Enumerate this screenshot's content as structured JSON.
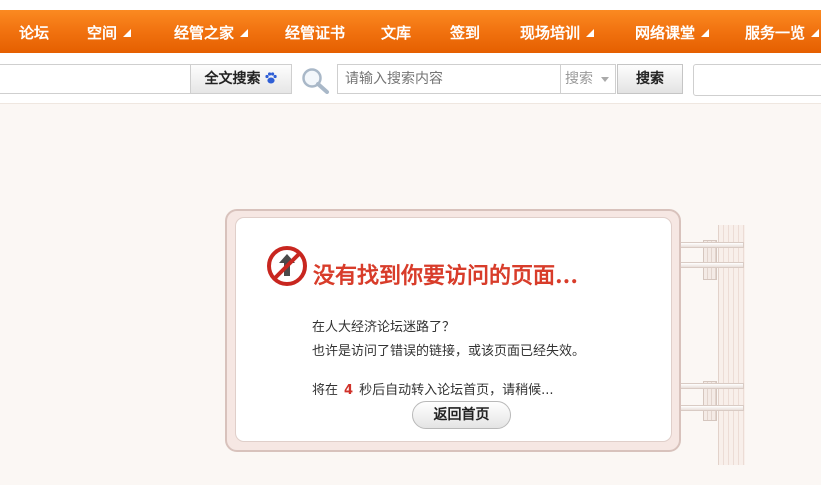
{
  "nav": {
    "items": [
      {
        "label": "论坛",
        "has_arrow": false
      },
      {
        "label": "空间",
        "has_arrow": true
      },
      {
        "label": "经管之家",
        "has_arrow": true
      },
      {
        "label": "经管证书",
        "has_arrow": false
      },
      {
        "label": "文库",
        "has_arrow": false
      },
      {
        "label": "签到",
        "has_arrow": false
      },
      {
        "label": "现场培训",
        "has_arrow": true
      },
      {
        "label": "网络课堂",
        "has_arrow": true
      },
      {
        "label": "服务一览",
        "has_arrow": true
      }
    ]
  },
  "search": {
    "fulltext_label": "全文搜索",
    "placeholder": "请输入搜索内容",
    "type_selected": "搜索",
    "button_label": "搜索"
  },
  "error": {
    "title": "没有找到你要访问的页面...",
    "line1": "在人大经济论坛迷路了？",
    "line2": "也许是访问了错误的链接，或该页面已经失效。",
    "countdown_prefix": "将在",
    "countdown_seconds": "4",
    "countdown_suffix": "秒后自动转入论坛首页，请稍候...",
    "back_button": "返回首页"
  },
  "colors": {
    "nav_orange": "#f27411",
    "error_red": "#d83c2a",
    "page_bg": "#fbf7f4"
  }
}
